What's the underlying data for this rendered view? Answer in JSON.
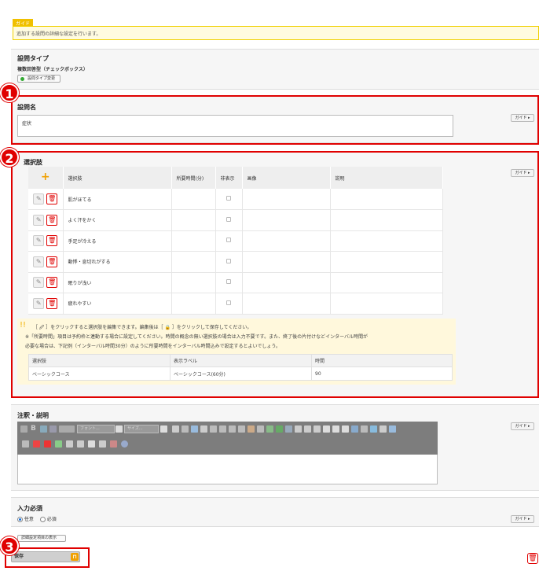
{
  "guide": {
    "tag": "ガイド",
    "text": "追加する設問の詳細な設定を行います。"
  },
  "question_type": {
    "title": "設問タイプ",
    "value": "複数回答型（チェックボックス）",
    "change_button": "設問タイプ変更"
  },
  "question_name": {
    "title": "設問名",
    "value": "症状",
    "guide_button": "ガイド ▸"
  },
  "options": {
    "title": "選択肢",
    "guide_button": "ガイド ▸",
    "headers": [
      "選択肢",
      "所要時間(分)",
      "非表示",
      "画像",
      "説明"
    ],
    "rows": [
      {
        "label": "肌がほてる"
      },
      {
        "label": "よく汗をかく"
      },
      {
        "label": "手足が冷える"
      },
      {
        "label": "動悸・息切れがする"
      },
      {
        "label": "眠りが浅い"
      },
      {
        "label": "疲れやすい"
      }
    ],
    "note_line1": "［ 🖉 ］をクリックすると選択肢を編集できます。編集後は［ 🔒 ］をクリックして保存してください。",
    "note_line2": "※「所要時間」項目は予約枠と連動する場合に設定してください。時間の概念の無い選択肢の場合は入力不要です。また、終了後の片付けなどインターバル時間が",
    "note_line3": "必要な場合は、下記例（インターバル時間30分）のように所要時間をインターバル時間込みで設定するとよいでしょう。",
    "course_headers": [
      "選択肢",
      "表示ラベル",
      "時間"
    ],
    "course_row": [
      "ベーシックコース",
      "ベーシックコース(60分)",
      "90"
    ]
  },
  "annotation": {
    "title": "注釈・説明",
    "guide_button": "ガイド ▸",
    "font_select": "フォント...",
    "size_select": "サイズ..."
  },
  "required": {
    "title": "入力必須",
    "optional": "任意",
    "mandatory": "必須",
    "guide_button": "ガイド ▸"
  },
  "detail_toggle": "詳細設定項目の表示",
  "save_label": "保存",
  "badges": [
    "1",
    "2",
    "3"
  ],
  "colors": {
    "accent_red": "#e00000",
    "guide_yellow": "#f0c000",
    "toolbar_gray": "#7d7d7d"
  }
}
